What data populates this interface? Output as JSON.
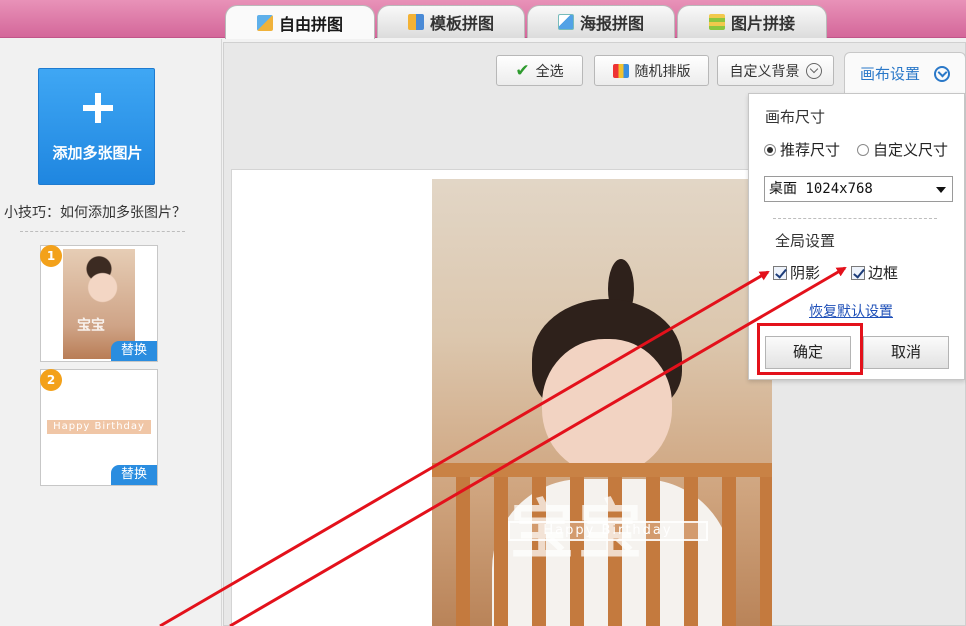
{
  "tabs": [
    {
      "label": "自由拼图",
      "icon": "free-collage-icon",
      "active": true
    },
    {
      "label": "模板拼图",
      "icon": "template-collage-icon",
      "active": false
    },
    {
      "label": "海报拼图",
      "icon": "poster-collage-icon",
      "active": false
    },
    {
      "label": "图片拼接",
      "icon": "image-join-icon",
      "active": false
    }
  ],
  "sidebar": {
    "add_button": "添加多张图片",
    "tip": "小技巧：如何添加多张图片？",
    "thumbnails": [
      {
        "num": "1",
        "replace": "替换",
        "watermark": "宝宝"
      },
      {
        "num": "2",
        "replace": "替换",
        "text": "Happy Birthday"
      }
    ]
  },
  "toolbar": {
    "select_all": "全选",
    "random_layout": "随机排版",
    "custom_bg": "自定义背景",
    "canvas_settings": "画布设置"
  },
  "canvas": {
    "watermark": "宝宝",
    "banner": "Happy Birthday"
  },
  "panel": {
    "size_title": "画布尺寸",
    "recommended": "推荐尺寸",
    "custom": "自定义尺寸",
    "selected_size": "桌面 1024x768",
    "global_title": "全局设置",
    "shadow": "阴影",
    "border": "边框",
    "restore": "恢复默认设置",
    "ok": "确定",
    "cancel": "取消"
  },
  "colors": {
    "accent": "#d4679a",
    "primary": "#1f86e0",
    "highlight": "#e3111b"
  }
}
